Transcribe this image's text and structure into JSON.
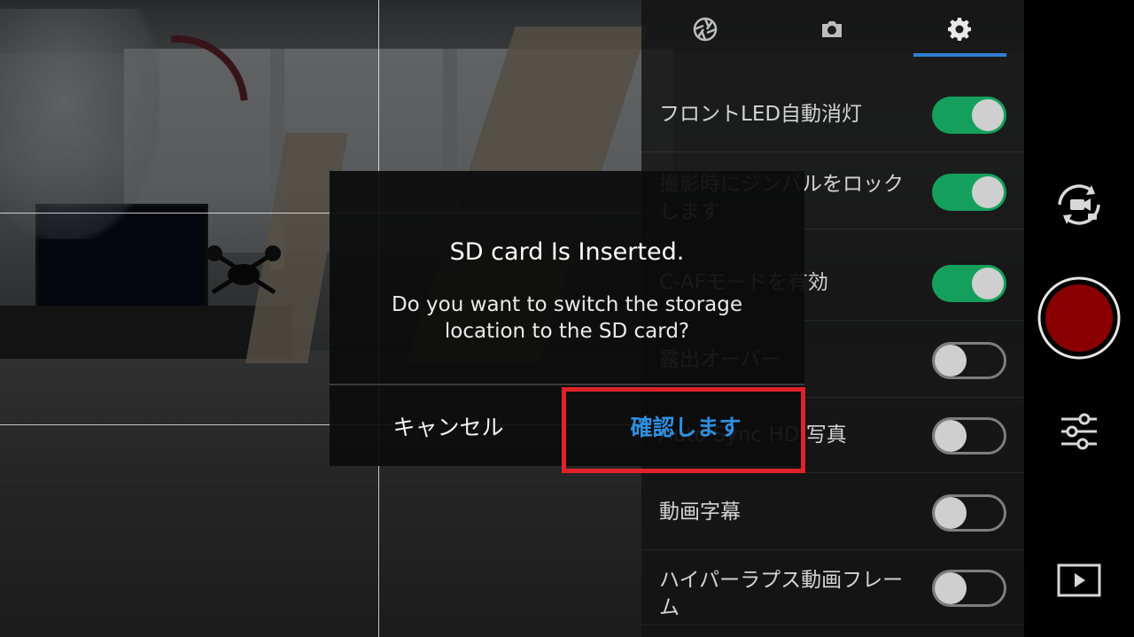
{
  "settings": {
    "tabs": [
      {
        "name": "aperture-tab",
        "icon": "aperture-icon",
        "active": false
      },
      {
        "name": "camera-tab",
        "icon": "camera-icon",
        "active": false
      },
      {
        "name": "settings-tab",
        "icon": "gear-icon",
        "active": true
      }
    ],
    "items": [
      {
        "label": "フロントLED自動消灯",
        "enabled": true
      },
      {
        "label": "撮影時にジンバルをロックします",
        "enabled": true
      },
      {
        "label": "C-AFモードを有効",
        "enabled": true
      },
      {
        "label": "露出オーバー",
        "enabled": false
      },
      {
        "label": "Auto Sync HD 写真",
        "enabled": false
      },
      {
        "label": "動画字幕",
        "enabled": false
      },
      {
        "label": "ハイパーラプス動画フレーム",
        "enabled": false
      }
    ]
  },
  "rail": {
    "switch_mode_icon": "switch-video-photo-icon",
    "record_icon": "record-button-icon",
    "adjust_icon": "sliders-icon",
    "playback_icon": "playback-icon",
    "record_color": "#8a0000"
  },
  "dialog": {
    "title": "SD card Is Inserted.",
    "message": "Do you want to switch the storage location to the SD card?",
    "cancel_label": "キャンセル",
    "confirm_label": "確認します"
  },
  "colors": {
    "accent": "#2f7fd6",
    "toggle_on": "#14a05c",
    "highlight": "#e0232b"
  }
}
